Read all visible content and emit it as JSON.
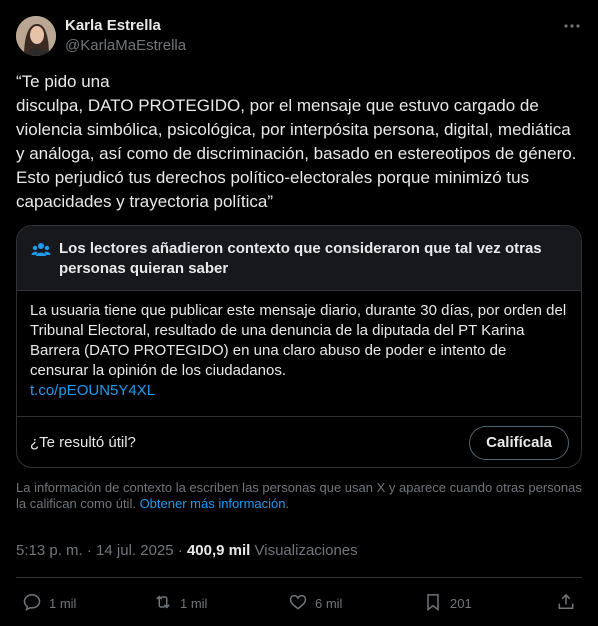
{
  "author": {
    "display_name": "Karla Estrella",
    "handle": "@KarlaMaEstrella",
    "avatar_icon": "avatar-photo"
  },
  "tweet": {
    "text": "“Te pido una\ndisculpa, DATO PROTEGIDO, por el mensaje que estuvo cargado de violencia simbólica, psicológica, por interpósita persona, digital, mediática y análoga, así como de discriminación, basado en estereotipos de género. Esto perjudicó tus derechos político-electorales porque minimizó tus capacidades y trayectoria política”"
  },
  "community_note": {
    "title": "Los lectores añadieron contexto que consideraron que tal vez otras personas quieran saber",
    "body": "La usuaria tiene que publicar este mensaje diario, durante 30 días, por orden del Tribunal Electoral, resultado de una denuncia de la diputada del PT Karina Barrera (DATO PROTEGIDO) en una claro abuso de poder e intento de censurar la opinión de los ciudadanos.",
    "link": "t.co/pEOUN5Y4XL",
    "useful_question": "¿Te resultó útil?",
    "rate_button": "Califícala"
  },
  "context_info": {
    "text": "La información de contexto la escriben las personas que usan X y aparece cuando otras personas la califican como útil. ",
    "link": "Obtener más información",
    "trailing": "."
  },
  "meta": {
    "time": "5:13 p. m.",
    "separator": " · ",
    "date": "14 jul. 2025",
    "views_count": "400,9 mil",
    "views_label": " Visualizaciones"
  },
  "actions": {
    "replies": "1 mil",
    "reposts": "1 mil",
    "likes": "6 mil",
    "bookmarks": "201"
  },
  "colors": {
    "background": "#000000",
    "text": "#e7e9ea",
    "secondary": "#71767b",
    "link": "#1d9bf0",
    "border": "#2f3336"
  }
}
